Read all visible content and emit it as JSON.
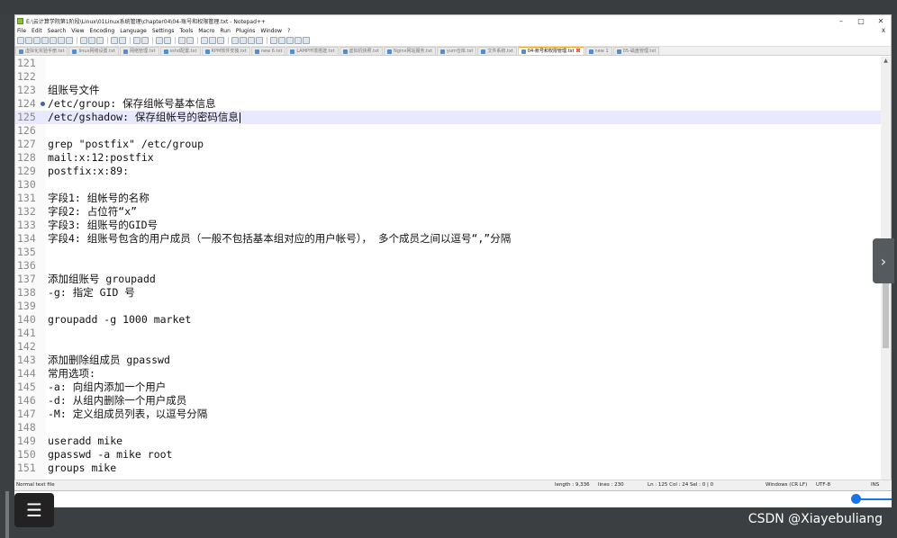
{
  "window": {
    "title": "E:\\云计算学院第1阶段\\Linux\\01Linux系统管理\\chapter04\\04-账号和权限管理.txt - Notepad++",
    "min": "–",
    "max": "□",
    "close": "✕"
  },
  "menu": [
    "File",
    "Edit",
    "Search",
    "View",
    "Encoding",
    "Language",
    "Settings",
    "Tools",
    "Macro",
    "Run",
    "Plugins",
    "Window",
    "?"
  ],
  "menu_close": "X",
  "tabs": [
    {
      "label": "虚拟化实验手册.txt",
      "active": false
    },
    {
      "label": "linux网络设置.txt",
      "active": false
    },
    {
      "label": "网络管理.txt",
      "active": false
    },
    {
      "label": "sshd配置.txt",
      "active": false
    },
    {
      "label": "RPM软件安装.txt",
      "active": false
    },
    {
      "label": "new 6.txt",
      "active": false
    },
    {
      "label": "LAMP环境搭建.txt",
      "active": false
    },
    {
      "label": "虚拟机快照.txt",
      "active": false
    },
    {
      "label": "Nginx网站服务.txt",
      "active": false
    },
    {
      "label": "yum仓库.txt",
      "active": false
    },
    {
      "label": "文件系统.txt",
      "active": false
    },
    {
      "label": "04-账号和权限管理.txt",
      "active": true
    },
    {
      "label": "new 1",
      "active": false
    },
    {
      "label": "05-磁盘管理.txt",
      "active": false
    }
  ],
  "editor": {
    "current_line": 125,
    "bookmark_line": 124,
    "lines": [
      {
        "n": "121",
        "t": ""
      },
      {
        "n": "122",
        "t": ""
      },
      {
        "n": "123",
        "t": "组账号文件"
      },
      {
        "n": "124",
        "t": "/etc/group: 保存组帐号基本信息"
      },
      {
        "n": "125",
        "t": "/etc/gshadow: 保存组帐号的密码信息"
      },
      {
        "n": "126",
        "t": ""
      },
      {
        "n": "127",
        "t": "grep \"postfix\" /etc/group"
      },
      {
        "n": "128",
        "t": "mail:x:12:postfix"
      },
      {
        "n": "129",
        "t": "postfix:x:89:"
      },
      {
        "n": "130",
        "t": ""
      },
      {
        "n": "131",
        "t": "字段1: 组帐号的名称"
      },
      {
        "n": "132",
        "t": "字段2: 占位符“x”"
      },
      {
        "n": "133",
        "t": "字段3: 组账号的GID号"
      },
      {
        "n": "134",
        "t": "字段4: 组账号包含的用户成员（一般不包括基本组对应的用户帐号）， 多个成员之间以逗号“,”分隔"
      },
      {
        "n": "135",
        "t": ""
      },
      {
        "n": "136",
        "t": ""
      },
      {
        "n": "137",
        "t": "添加组账号 groupadd"
      },
      {
        "n": "138",
        "t": "-g: 指定 GID 号"
      },
      {
        "n": "139",
        "t": ""
      },
      {
        "n": "140",
        "t": "groupadd -g 1000 market"
      },
      {
        "n": "141",
        "t": ""
      },
      {
        "n": "142",
        "t": ""
      },
      {
        "n": "143",
        "t": "添加删除组成员 gpasswd"
      },
      {
        "n": "144",
        "t": "常用选项:"
      },
      {
        "n": "145",
        "t": "-a: 向组内添加一个用户"
      },
      {
        "n": "146",
        "t": "-d: 从组内删除一个用户成员"
      },
      {
        "n": "147",
        "t": "-M: 定义组成员列表，以逗号分隔"
      },
      {
        "n": "148",
        "t": ""
      },
      {
        "n": "149",
        "t": "useradd mike"
      },
      {
        "n": "150",
        "t": "gpasswd -a mike root"
      },
      {
        "n": "151",
        "t": "groups mike"
      }
    ]
  },
  "status": {
    "type": "Normal text file",
    "length": "length : 9,336",
    "lines": "lines : 230",
    "pos": "Ln : 125   Col : 24   Sel : 0 | 0",
    "eol": "Windows (CR LF)",
    "enc": "UTF-8",
    "mode": "INS"
  },
  "player": {
    "progress": 0.96,
    "menu_icon": "list-menu-icon",
    "panel_icon": "chevron-right-icon"
  },
  "watermark": "CSDN @Xiayebuliang",
  "colors": {
    "current_line": "#e8e8ff",
    "accent": "#1a73e8",
    "active_tab": "#f5a623"
  }
}
